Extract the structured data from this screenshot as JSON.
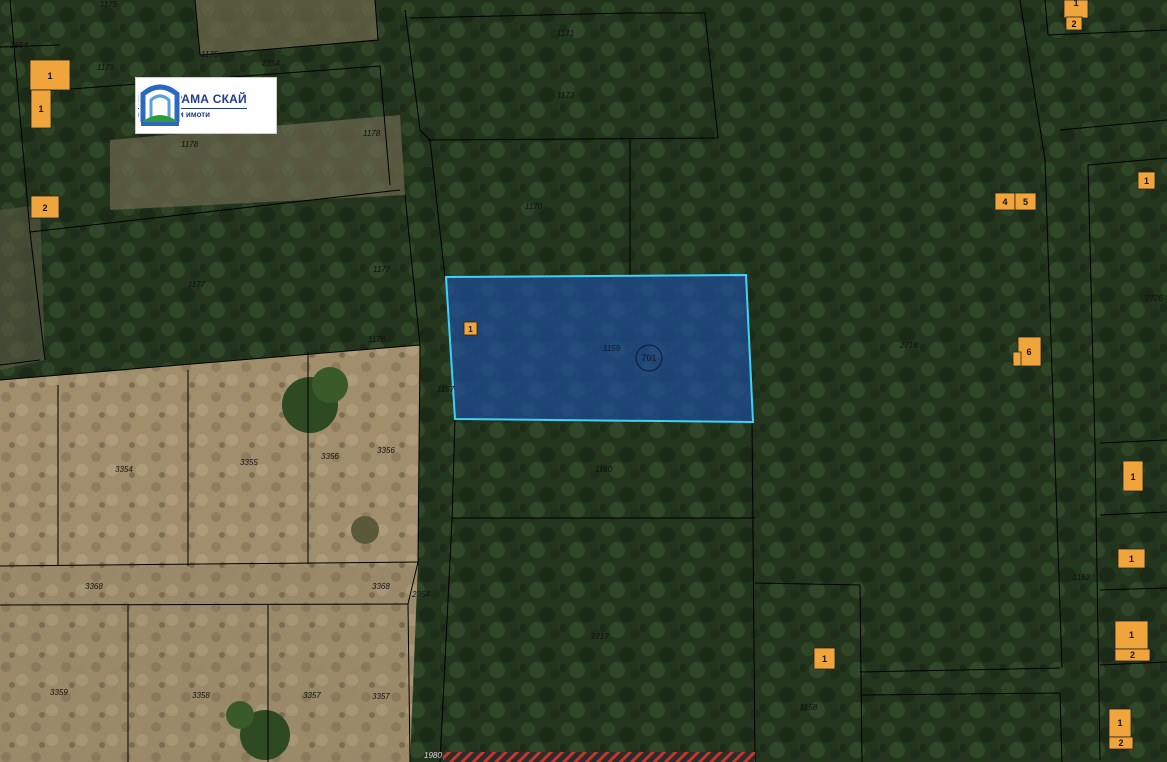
{
  "map": {
    "highlighted_parcel": {
      "number": "1159",
      "building_label": "1",
      "circle_label": "701",
      "west_edge_label": "1157"
    },
    "parcel_labels": [
      {
        "id": "p1175a",
        "text": "1175"
      },
      {
        "id": "p1175b",
        "text": "1175"
      },
      {
        "id": "p2354a",
        "text": "2354"
      },
      {
        "id": "p1179",
        "text": "1179"
      },
      {
        "id": "p1178a",
        "text": "1178"
      },
      {
        "id": "p1178b",
        "text": "1178"
      },
      {
        "id": "p1171",
        "text": "1171"
      },
      {
        "id": "p1173",
        "text": "1173"
      },
      {
        "id": "p1170",
        "text": "1170"
      },
      {
        "id": "p1177a",
        "text": "1177"
      },
      {
        "id": "p1177b",
        "text": "1177"
      },
      {
        "id": "p1176",
        "text": "1176"
      },
      {
        "id": "p2718",
        "text": "2718"
      },
      {
        "id": "p2726",
        "text": "2726"
      },
      {
        "id": "p1160",
        "text": "1160"
      },
      {
        "id": "p3354",
        "text": "3354"
      },
      {
        "id": "p3355",
        "text": "3355"
      },
      {
        "id": "p3356a",
        "text": "3356"
      },
      {
        "id": "p3356b",
        "text": "3356"
      },
      {
        "id": "p3368a",
        "text": "3368"
      },
      {
        "id": "p3368b",
        "text": "3368"
      },
      {
        "id": "p2354b",
        "text": "2354"
      },
      {
        "id": "p2717",
        "text": "2717"
      },
      {
        "id": "p3359",
        "text": "3359"
      },
      {
        "id": "p3358",
        "text": "3358"
      },
      {
        "id": "p3357a",
        "text": "3357"
      },
      {
        "id": "p3357b",
        "text": "3357"
      },
      {
        "id": "p1158",
        "text": "1158"
      },
      {
        "id": "p1162",
        "text": "1162"
      },
      {
        "id": "p1864",
        "text": "1864"
      },
      {
        "id": "p1980",
        "text": "1980"
      }
    ],
    "buildings": [
      {
        "id": "b1",
        "text": "1"
      },
      {
        "id": "b2",
        "text": "1"
      },
      {
        "id": "b3",
        "text": "2"
      },
      {
        "id": "b4",
        "text": "1"
      },
      {
        "id": "b5",
        "text": "2"
      },
      {
        "id": "b6",
        "text": "1"
      },
      {
        "id": "b7",
        "text": "4"
      },
      {
        "id": "b8",
        "text": "5"
      },
      {
        "id": "b9",
        "text": "6"
      },
      {
        "id": "b10",
        "text": "1"
      },
      {
        "id": "b11",
        "text": "1"
      },
      {
        "id": "b12",
        "text": "1"
      },
      {
        "id": "b13",
        "text": "1"
      },
      {
        "id": "b14",
        "text": "2"
      },
      {
        "id": "b15",
        "text": "1"
      },
      {
        "id": "b16",
        "text": "2"
      }
    ],
    "colors": {
      "forest": "#25351f",
      "field": "#9c8a6a",
      "highlight_fill": "#1e4f9c",
      "highlight_stroke": "#3fd2f5",
      "building": "#f0a53c",
      "boundary": "#000000"
    }
  },
  "logo": {
    "title": "ПАНОРАМА СКАЙ",
    "subtitle": "недвижими имоти"
  }
}
